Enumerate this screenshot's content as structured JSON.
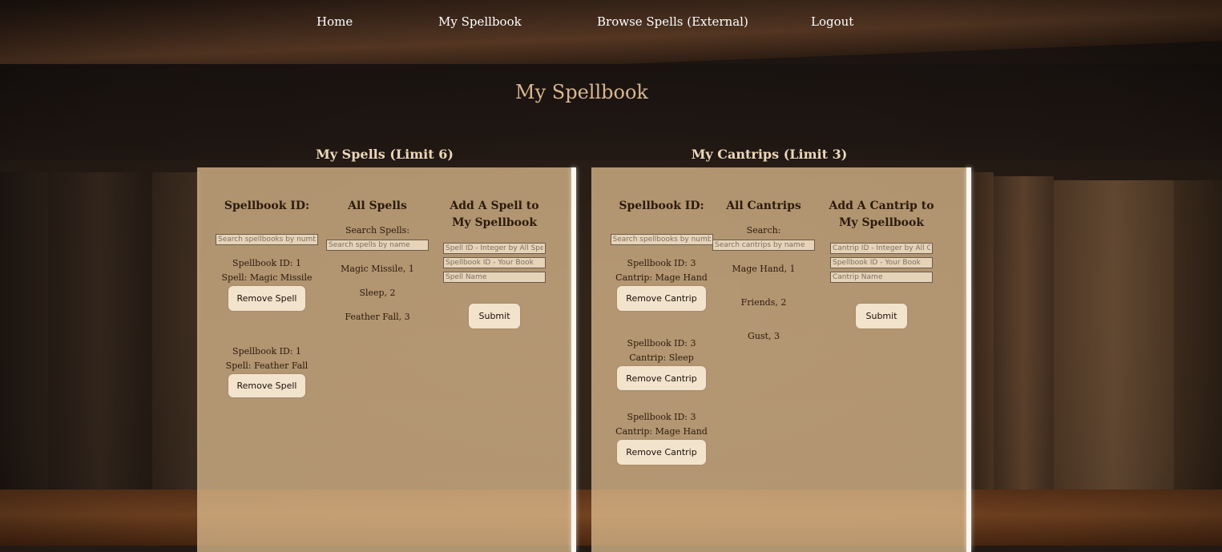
{
  "nav": {
    "home": "Home",
    "spellbook": "My Spellbook",
    "browse": "Browse Spells (External)",
    "logout": "Logout"
  },
  "page_title": "My Spellbook",
  "spells": {
    "section_title": "My Spells (Limit 6)",
    "spellbook_col": {
      "heading": "Spellbook ID:",
      "search_placeholder": "Search spellbooks by number",
      "entries": [
        {
          "id_line": "Spellbook ID: 1",
          "name_line": "Spell: Magic Missile",
          "button": "Remove Spell"
        },
        {
          "id_line": "Spellbook ID: 1",
          "name_line": "Spell: Feather Fall",
          "button": "Remove Spell"
        }
      ]
    },
    "all_col": {
      "heading": "All Spells",
      "search_label": "Search Spells:",
      "search_placeholder": "Search spells by name",
      "items": [
        "Magic Missile, 1",
        "Sleep, 2",
        "Feather Fall, 3"
      ]
    },
    "add_col": {
      "heading": "Add A Spell to My Spellbook",
      "id_placeholder": "Spell ID - Integer by All Spells",
      "book_placeholder": "Spellbook ID - Your Book",
      "name_placeholder": "Spell Name",
      "submit": "Submit"
    }
  },
  "cantrips": {
    "section_title": "My Cantrips (Limit 3)",
    "spellbook_col": {
      "heading": "Spellbook ID:",
      "search_placeholder": "Search spellbooks by number",
      "entries": [
        {
          "id_line": "Spellbook ID: 3",
          "name_line": "Cantrip: Mage Hand",
          "button": "Remove Cantrip"
        },
        {
          "id_line": "Spellbook ID: 3",
          "name_line": "Cantrip: Sleep",
          "button": "Remove Cantrip"
        },
        {
          "id_line": "Spellbook ID: 3",
          "name_line": "Cantrip: Mage Hand",
          "button": "Remove Cantrip"
        }
      ]
    },
    "all_col": {
      "heading": "All Cantrips",
      "search_label": "Search:",
      "search_placeholder": "Search cantrips by name",
      "items": [
        "Mage Hand, 1",
        "Friends, 2",
        "Gust, 3"
      ]
    },
    "add_col": {
      "heading": "Add A Cantrip to My Spellbook",
      "id_placeholder": "Cantrip ID - Integer by All Cantrips",
      "book_placeholder": "Spellbook ID - Your Book",
      "name_placeholder": "Cantrip Name",
      "submit": "Submit"
    }
  }
}
